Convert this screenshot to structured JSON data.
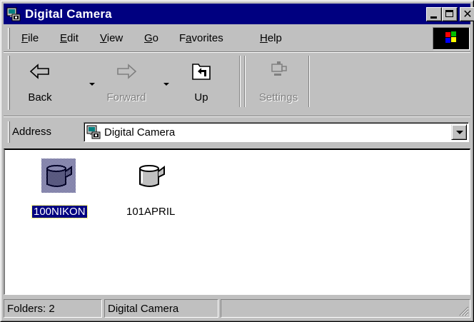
{
  "window": {
    "title": "Digital Camera"
  },
  "menu": {
    "items": [
      {
        "label": "File",
        "accel": "F",
        "rest": "ile"
      },
      {
        "label": "Edit",
        "accel": "E",
        "rest": "dit"
      },
      {
        "label": "View",
        "accel": "V",
        "rest": "iew"
      },
      {
        "label": "Go",
        "accel": "G",
        "rest": "o"
      },
      {
        "label": "Favorites",
        "pre": "F",
        "accel": "a",
        "rest": "vorites"
      },
      {
        "label": "Help",
        "accel": "H",
        "rest": "elp"
      }
    ]
  },
  "toolbar": {
    "back_label": "Back",
    "forward_label": "Forward",
    "up_label": "Up",
    "settings_label": "Settings"
  },
  "address": {
    "label": "Address",
    "value": "Digital Camera"
  },
  "folders": [
    {
      "name": "100NIKON",
      "selected": true
    },
    {
      "name": "101APRIL",
      "selected": false
    }
  ],
  "status": {
    "count": "Folders: 2",
    "location": "Digital Camera"
  },
  "colors": {
    "titlebar": "#000080",
    "face": "#c0c0c0",
    "selection": "#000080"
  }
}
